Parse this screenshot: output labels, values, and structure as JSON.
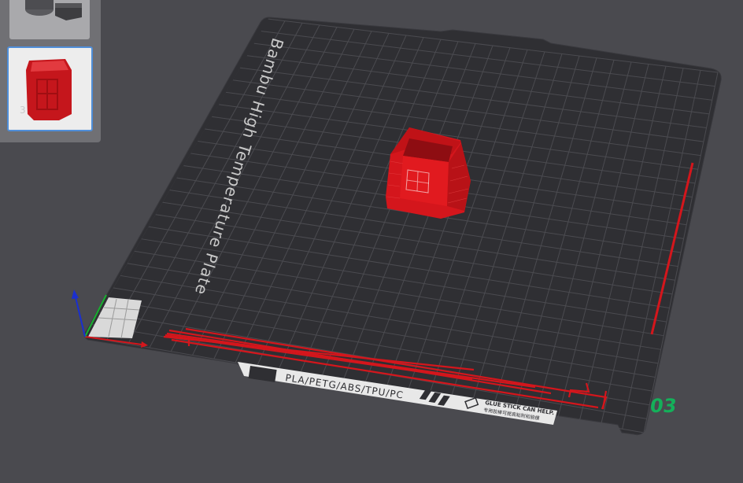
{
  "plate": {
    "brand_text": "Bambu High Temperature Plate",
    "materials_text": "PLA/PETG/ABS/TPU/PC",
    "glue_text": "GLUE STICK CAN HELP.",
    "glue_subtext": "专用胶棒可提高粘附和脱模",
    "plate_number": "03"
  },
  "object_list": {
    "visible_index": "3"
  },
  "colors": {
    "background": "#4a4a4f",
    "plate": "#2f2f33",
    "grid": "#4b4b50",
    "model": "#d4161c",
    "purge_lines": "#d4161c",
    "plate_number": "#14b05a",
    "selection_border": "#4f8ed8",
    "axis_x": "#d4161c",
    "axis_y": "#18b030",
    "axis_z": "#1a2fd0"
  },
  "icons": [
    "model-thumbnail-icon",
    "axis-gizmo-icon"
  ]
}
